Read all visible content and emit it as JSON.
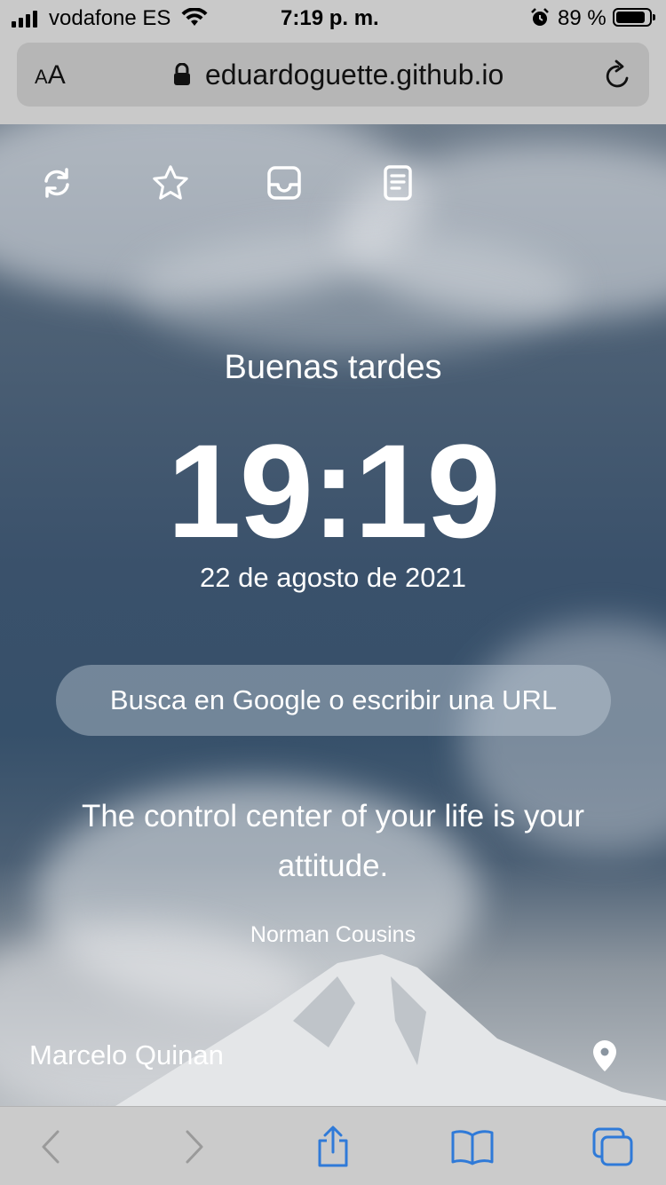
{
  "status_bar": {
    "carrier": "vodafone ES",
    "time": "7:19 p. m.",
    "battery_percent": "89 %",
    "battery_level": 0.89,
    "icons": [
      "signal-icon",
      "wifi-icon",
      "alarm-icon",
      "battery-icon"
    ]
  },
  "browser": {
    "text_size_label": "AA",
    "url": "eduardoguette.github.io",
    "icons": [
      "lock-icon",
      "reload-icon"
    ]
  },
  "toolbar": {
    "icons": [
      "refresh-icon",
      "star-icon",
      "inbox-icon",
      "notes-icon"
    ]
  },
  "main": {
    "greeting": "Buenas tardes",
    "clock": "19:19",
    "date": "22 de agosto de 2021",
    "search_placeholder": "Busca en Google o escribir una URL",
    "quote": "The control center of your life is your attitude.",
    "quote_author": "Norman Cousins",
    "photo_credit": "Marcelo Quinan",
    "location_icon": "location-pin-icon"
  },
  "bottom_toolbar": {
    "icons": [
      "back-icon",
      "forward-icon",
      "share-icon",
      "bookmarks-icon",
      "tabs-icon"
    ],
    "accent_color": "#2f7ad8",
    "disabled_color": "#9a9a9a"
  }
}
